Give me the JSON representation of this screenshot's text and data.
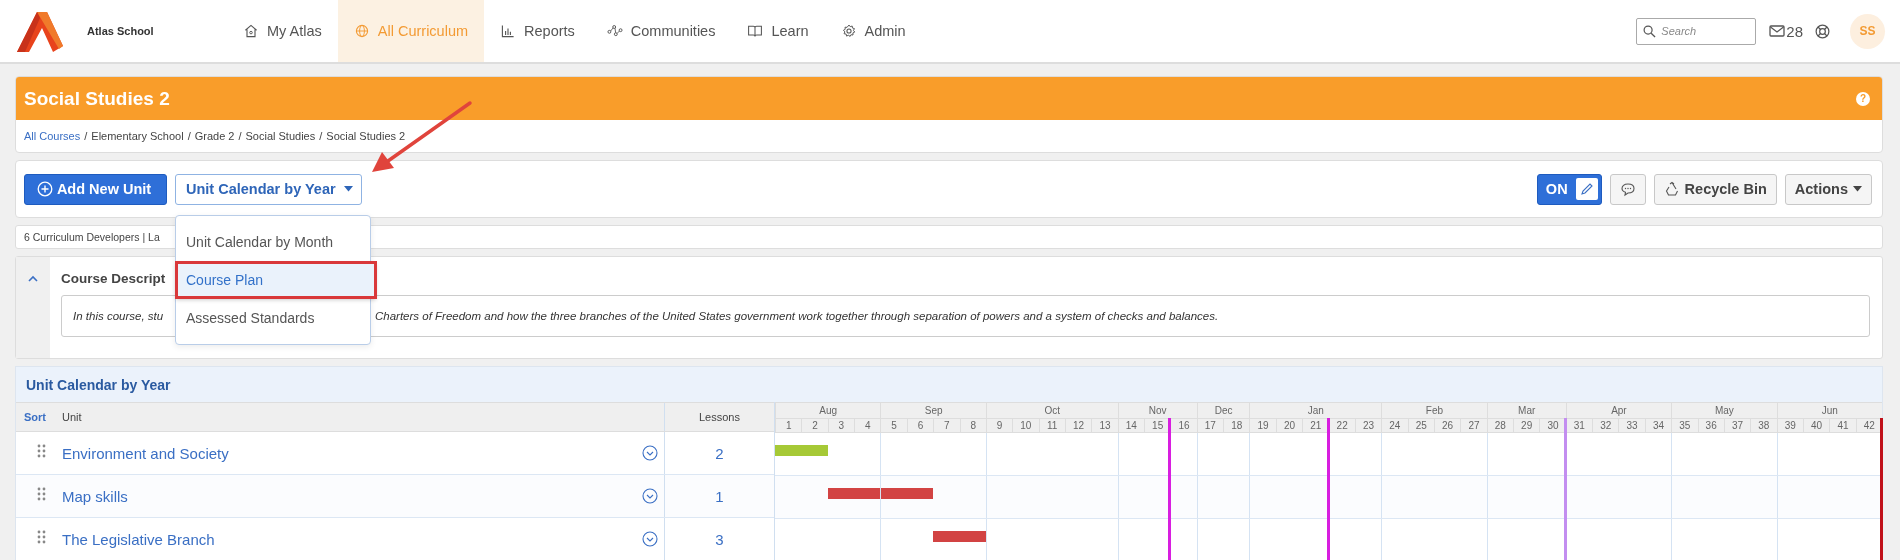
{
  "app": {
    "name": "Atlas School"
  },
  "nav": [
    {
      "label": "My Atlas",
      "selected": false
    },
    {
      "label": "All Curriculum",
      "selected": true
    },
    {
      "label": "Reports",
      "selected": false
    },
    {
      "label": "Communities",
      "selected": false
    },
    {
      "label": "Learn",
      "selected": false
    },
    {
      "label": "Admin",
      "selected": false
    }
  ],
  "header_tools": {
    "search": {
      "placeholder": "Search"
    },
    "messages_count": "28",
    "avatar": "SS"
  },
  "course": {
    "title": "Social Studies 2",
    "help": "?"
  },
  "breadcrumb": {
    "separator": "/",
    "items": [
      "All Courses",
      "Elementary School",
      "Grade 2",
      "Social Studies",
      "Social Studies 2"
    ]
  },
  "toolbar": {
    "add_button": "Add New Unit",
    "view_select": {
      "label": "Unit Calendar by Year",
      "expanded": true,
      "options": [
        {
          "label": "Unit Calendar by Month",
          "selected": false,
          "annotated": false
        },
        {
          "label": "Course Plan",
          "selected": true,
          "annotated": true
        },
        {
          "label": "Assessed Standards",
          "selected": false,
          "annotated": false
        }
      ]
    },
    "edit_toggle": {
      "label": "ON",
      "on": true
    },
    "recycle_bin": "Recycle Bin",
    "actions": "Actions"
  },
  "info_line": "6 Curriculum Developers | La",
  "description": {
    "title": "Course Descript",
    "expanded": true,
    "text_parts": [
      "In this course, stu",
      "Charters of Freedom and how the three branches of the United States government work together through separation of powers and a system of checks and balances."
    ]
  },
  "calendar": {
    "title": "Unit Calendar by Year",
    "columns": {
      "sort": "Sort",
      "unit": "Unit",
      "lessons": "Lessons"
    },
    "months": [
      {
        "label": "Aug",
        "weeks": [
          {
            "label": "1"
          },
          {
            "label": "2"
          },
          {
            "label": "3"
          },
          {
            "label": "4"
          }
        ]
      },
      {
        "label": "Sep",
        "weeks": [
          {
            "label": "5"
          },
          {
            "label": "6"
          },
          {
            "label": "7"
          },
          {
            "label": "8"
          }
        ]
      },
      {
        "label": "Oct",
        "weeks": [
          {
            "label": "9"
          },
          {
            "label": "10"
          },
          {
            "label": "11"
          },
          {
            "label": "12"
          },
          {
            "label": "13"
          }
        ]
      },
      {
        "label": "Nov",
        "weeks": [
          {
            "label": "14"
          },
          {
            "label": "15",
            "marker": {
              "color": "#d81ee0"
            }
          },
          {
            "label": "16"
          }
        ]
      },
      {
        "label": "Dec",
        "weeks": [
          {
            "label": "17"
          },
          {
            "label": "18"
          }
        ]
      },
      {
        "label": "Jan",
        "weeks": [
          {
            "label": "19"
          },
          {
            "label": "20"
          },
          {
            "label": "21",
            "marker": {
              "color": "#d81ee0"
            }
          },
          {
            "label": "22"
          },
          {
            "label": "23"
          }
        ]
      },
      {
        "label": "Feb",
        "weeks": [
          {
            "label": "24"
          },
          {
            "label": "25"
          },
          {
            "label": "26"
          },
          {
            "label": "27"
          }
        ]
      },
      {
        "label": "Mar",
        "weeks": [
          {
            "label": "28"
          },
          {
            "label": "29"
          },
          {
            "label": "30",
            "marker": {
              "color": "#c38ef0"
            }
          }
        ]
      },
      {
        "label": "Apr",
        "weeks": [
          {
            "label": "31"
          },
          {
            "label": "32"
          },
          {
            "label": "33"
          },
          {
            "label": "34"
          }
        ]
      },
      {
        "label": "May",
        "weeks": [
          {
            "label": "35"
          },
          {
            "label": "36"
          },
          {
            "label": "37"
          },
          {
            "label": "38"
          }
        ]
      },
      {
        "label": "Jun",
        "weeks": [
          {
            "label": "39"
          },
          {
            "label": "40"
          },
          {
            "label": "41"
          },
          {
            "label": "42",
            "marker": {
              "color": "#c0101a"
            }
          }
        ]
      }
    ],
    "units": [
      {
        "name": "Environment and Society",
        "lessons": "2",
        "bar": {
          "color": "#a6c936"
        },
        "scheduled_weeks": [
          true,
          true,
          false,
          false,
          false,
          false,
          false,
          false,
          false,
          false,
          false,
          false,
          false,
          false,
          false,
          false,
          false,
          false,
          false,
          false,
          false,
          false,
          false,
          false,
          false,
          false,
          false,
          false,
          false,
          false,
          false,
          false,
          false,
          false,
          false,
          false,
          false,
          false,
          false,
          false,
          false,
          false
        ]
      },
      {
        "name": "Map skills",
        "lessons": "1",
        "bar": {
          "color": "#d24343"
        },
        "scheduled_weeks": [
          false,
          false,
          true,
          true,
          true,
          true,
          false,
          false,
          false,
          false,
          false,
          false,
          false,
          false,
          false,
          false,
          false,
          false,
          false,
          false,
          false,
          false,
          false,
          false,
          false,
          false,
          false,
          false,
          false,
          false,
          false,
          false,
          false,
          false,
          false,
          false,
          false,
          false,
          false,
          false,
          false,
          false
        ]
      },
      {
        "name": "The Legislative Branch",
        "lessons": "3",
        "bar": {
          "color": "#d24343"
        },
        "scheduled_weeks": [
          false,
          false,
          false,
          false,
          false,
          false,
          true,
          true,
          false,
          false,
          false,
          false,
          false,
          false,
          false,
          false,
          false,
          false,
          false,
          false,
          false,
          false,
          false,
          false,
          false,
          false,
          false,
          false,
          false,
          false,
          false,
          false,
          false,
          false,
          false,
          false,
          false,
          false,
          false,
          false,
          false,
          false
        ]
      }
    ]
  }
}
